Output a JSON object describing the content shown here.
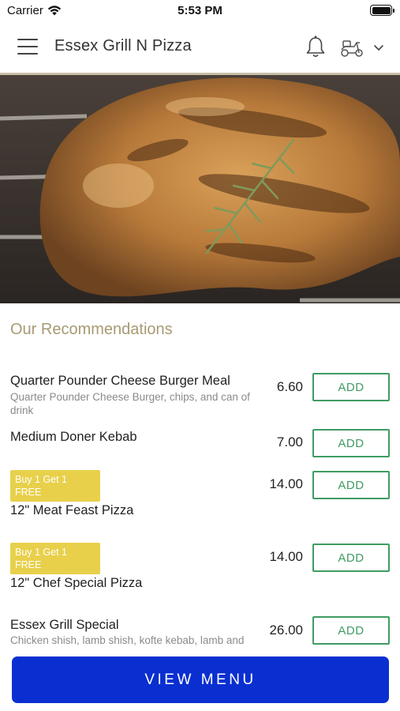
{
  "status_bar": {
    "carrier": "Carrier",
    "time": "5:53 PM"
  },
  "header": {
    "title": "Essex Grill N Pizza"
  },
  "section": {
    "title": "Our Recommendations"
  },
  "items": [
    {
      "name": "Quarter Pounder Cheese Burger Meal",
      "description": "Quarter Pounder Cheese Burger, chips, and can of drink",
      "price": "6.60",
      "add_label": "ADD"
    },
    {
      "name": "Medium Doner Kebab",
      "price": "7.00",
      "add_label": "ADD"
    },
    {
      "name": "12\" Meat Feast Pizza",
      "badge": "Buy 1 Get 1 FREE",
      "price": "14.00",
      "add_label": "ADD"
    },
    {
      "name": "12\" Chef Special Pizza",
      "badge": "Buy 1 Get 1 FREE",
      "price": "14.00",
      "add_label": "ADD"
    },
    {
      "name": "Essex Grill Special",
      "description": "Chicken shish, lamb shish, kofte kebab, lamb and",
      "price": "26.00",
      "add_label": "ADD"
    }
  ],
  "footer": {
    "view_menu_label": "VIEW MENU"
  },
  "colors": {
    "accent_green": "#3f9c62",
    "badge_yellow": "#e8d04b",
    "primary_blue": "#0a2fd0",
    "section_gold": "#a79a73"
  },
  "icons": [
    "wifi-icon",
    "battery-icon",
    "hamburger-menu-icon",
    "bell-icon",
    "scooter-delivery-icon",
    "chevron-down-icon"
  ]
}
